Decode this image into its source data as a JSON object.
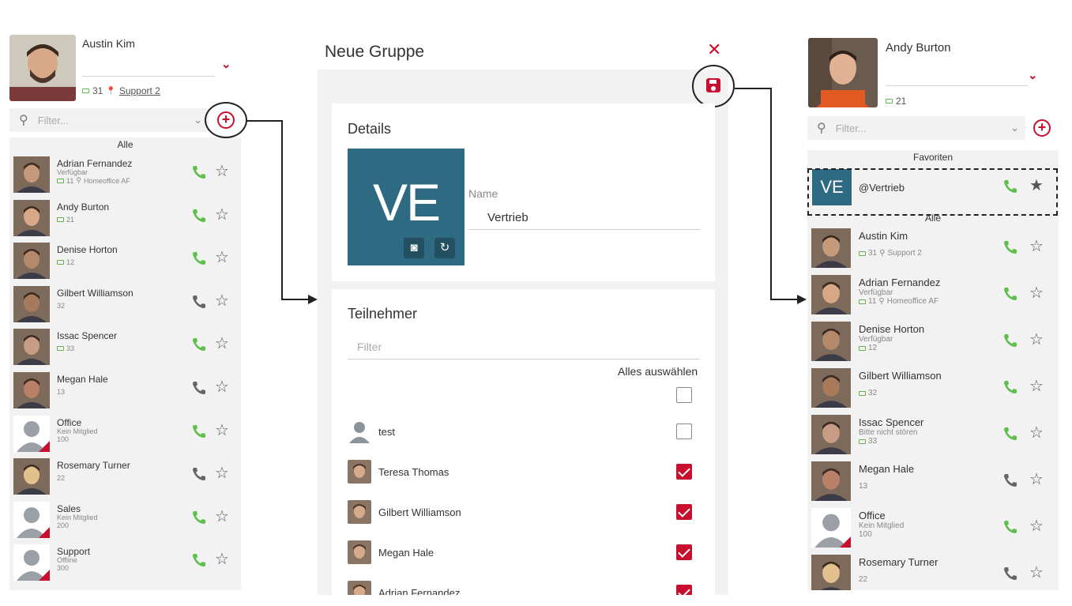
{
  "colors": {
    "accent": "#c8102e",
    "call_green": "#5fbf4c",
    "call_gray": "#666666",
    "tile_blue": "#2e6b82",
    "panel_bg": "#f2f2f2"
  },
  "left_panel": {
    "user_name": "Austin Kim",
    "user_extension": "31",
    "user_location": "Support 2",
    "filter_placeholder": "Filter...",
    "section_all": "Alle",
    "contacts": [
      {
        "name": "Adrian Fernandez",
        "status": "Verfügbar",
        "meta": "11",
        "location": "Homeoffice AF",
        "call": "green"
      },
      {
        "name": "Andy Burton",
        "status": "",
        "meta": "21",
        "location": "",
        "call": "green"
      },
      {
        "name": "Denise Horton",
        "status": "",
        "meta": "12",
        "location": "",
        "call": "green"
      },
      {
        "name": "Gilbert Williamson",
        "status": "",
        "meta": "32",
        "location": "",
        "call": "gray"
      },
      {
        "name": "Issac Spencer",
        "status": "",
        "meta": "33",
        "location": "",
        "call": "green"
      },
      {
        "name": "Megan Hale",
        "status": "",
        "meta": "13",
        "location": "",
        "call": "gray"
      },
      {
        "name": "Office",
        "status": "Kein Mitglied",
        "meta": "100",
        "location": "",
        "call": "green"
      },
      {
        "name": "Rosemary Turner",
        "status": "",
        "meta": "22",
        "location": "",
        "call": "gray"
      },
      {
        "name": "Sales",
        "status": "Kein Mitglied",
        "meta": "200",
        "location": "",
        "call": "green"
      },
      {
        "name": "Support",
        "status": "Offline",
        "meta": "300",
        "location": "",
        "call": "green"
      }
    ]
  },
  "modal": {
    "title": "Neue Gruppe",
    "close_glyph": "✕",
    "details_title": "Details",
    "avatar_initials": "VE",
    "name_label": "Name",
    "name_value": "Vertrieb",
    "participants_title": "Teilnehmer",
    "participants_filter": "Filter",
    "select_all": "Alles auswählen",
    "participants": [
      {
        "name": "test",
        "checked": false
      },
      {
        "name": "Teresa Thomas",
        "checked": true
      },
      {
        "name": "Gilbert Williamson",
        "checked": true
      },
      {
        "name": "Megan Hale",
        "checked": true
      },
      {
        "name": "Adrian Fernandez",
        "checked": true
      }
    ]
  },
  "right_panel": {
    "user_name": "Andy Burton",
    "user_extension": "21",
    "filter_placeholder": "Filter...",
    "section_favorites": "Favoriten",
    "section_all": "Alle",
    "favorite": {
      "initials": "VE",
      "name": "@Vertrieb"
    },
    "contacts": [
      {
        "name": "Austin Kim",
        "status": "",
        "meta": "31",
        "location": "Support 2",
        "call": "green"
      },
      {
        "name": "Adrian Fernandez",
        "status": "Verfügbar",
        "meta": "11",
        "location": "Homeoffice AF",
        "call": "green"
      },
      {
        "name": "Denise Horton",
        "status": "Verfügbar",
        "meta": "12",
        "location": "",
        "call": "green"
      },
      {
        "name": "Gilbert Williamson",
        "status": "",
        "meta": "32",
        "location": "",
        "call": "green"
      },
      {
        "name": "Issac Spencer",
        "status": "Bitte nicht stören",
        "meta": "33",
        "location": "",
        "call": "green"
      },
      {
        "name": "Megan Hale",
        "status": "",
        "meta": "13",
        "location": "",
        "call": "gray"
      },
      {
        "name": "Office",
        "status": "Kein Mitglied",
        "meta": "100",
        "location": "",
        "call": "green"
      },
      {
        "name": "Rosemary Turner",
        "status": "",
        "meta": "22",
        "location": "",
        "call": "gray"
      }
    ]
  }
}
